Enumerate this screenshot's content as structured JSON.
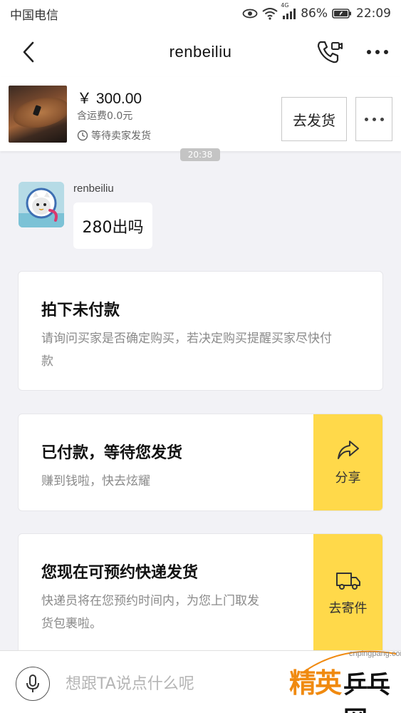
{
  "status_bar": {
    "carrier": "中国电信",
    "network": "4G",
    "battery": "86%",
    "time": "22:09",
    "icons": [
      "eye-icon",
      "wifi-icon",
      "signal-icon",
      "battery-icon"
    ]
  },
  "nav": {
    "title": "renbeiliu",
    "icons": [
      "back-icon",
      "phone-video-icon",
      "more-icon"
    ]
  },
  "product": {
    "price": "￥ 300.00",
    "shipping_fee": "含运费0.0元",
    "status": "等待卖家发货",
    "ship_button": "去发货"
  },
  "chat": {
    "timestamp": "20:38",
    "messages": [
      {
        "sender": "renbeiliu",
        "text": "280出吗"
      }
    ]
  },
  "cards": [
    {
      "title": "拍下未付款",
      "desc": [
        "请询问买家是否确定购买，若决定购买提醒买家尽快付",
        "款"
      ]
    },
    {
      "title": "已付款，等待您发货",
      "desc": [
        "赚到钱啦，快去炫耀"
      ],
      "action_label": "分享",
      "action_icon": "share-icon"
    },
    {
      "title": "您现在可预约快递发货",
      "desc": [
        "快递员将在您预约时间内，为您上门取发",
        "货包裹啦。"
      ],
      "action_label": "去寄件",
      "action_icon": "truck-icon"
    }
  ],
  "input": {
    "placeholder": "想跟TA说点什么呢"
  },
  "watermark": {
    "url": "cnpingpang.com",
    "text1": "精英",
    "text2": "乒乓网"
  },
  "colors": {
    "accent_yellow": "#ffd94a",
    "background": "#f2f2f6"
  }
}
